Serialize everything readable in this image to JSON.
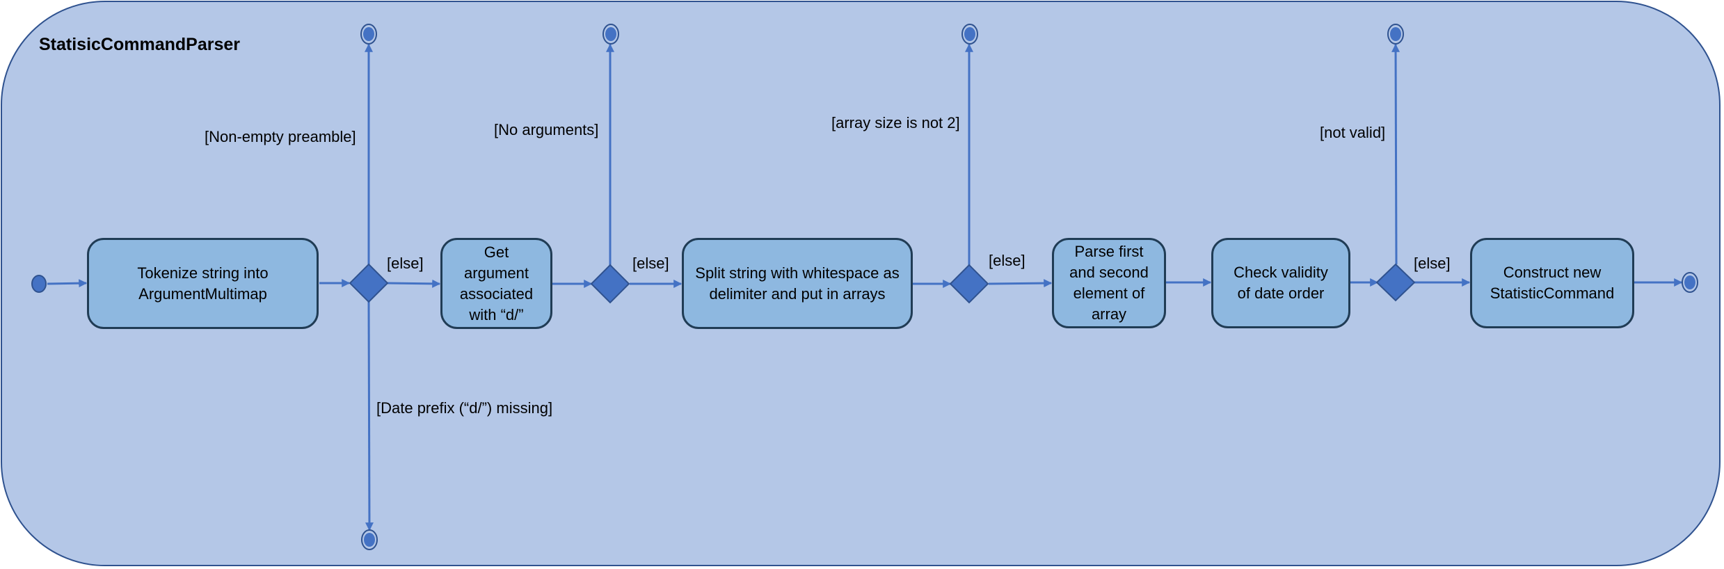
{
  "diagram": {
    "title": "StatisicCommandParser",
    "colors": {
      "frame_fill": "#b4c7e7",
      "frame_border": "#2f528f",
      "action_fill": "#8eb8e0",
      "action_border": "#203c55",
      "flow": "#4472c4",
      "node_fill": "#4472c4"
    },
    "actions": [
      {
        "id": "tokenize",
        "label": "Tokenize string into ArgumentMultimap"
      },
      {
        "id": "get-argument",
        "label": "Get argument associated with “d/”"
      },
      {
        "id": "split-string",
        "label": "Split string with whitespace as delimiter and put in arrays"
      },
      {
        "id": "parse-elements",
        "label": "Parse first and second element of array"
      },
      {
        "id": "check-validity",
        "label": "Check validity of date order"
      },
      {
        "id": "construct-command",
        "label": "Construct new StatisticCommand"
      }
    ],
    "decisions": [
      {
        "id": "decision-1",
        "else_label": "[else]",
        "guards": [
          {
            "direction": "up",
            "label": "[Non-empty preamble]"
          },
          {
            "direction": "down",
            "label": "[Date prefix (“d/”) missing]"
          }
        ]
      },
      {
        "id": "decision-2",
        "else_label": "[else]",
        "guards": [
          {
            "direction": "up",
            "label": "[No arguments]"
          }
        ]
      },
      {
        "id": "decision-3",
        "else_label": "[else]",
        "guards": [
          {
            "direction": "up",
            "label": "[array size is not 2]"
          }
        ]
      },
      {
        "id": "decision-4",
        "else_label": "[else]",
        "guards": [
          {
            "direction": "up",
            "label": "[not valid]"
          }
        ]
      }
    ],
    "flows": [
      {
        "from": "initial",
        "to": "tokenize"
      },
      {
        "from": "tokenize",
        "to": "decision-1"
      },
      {
        "from": "decision-1",
        "to": "get-argument",
        "guard": "[else]"
      },
      {
        "from": "decision-1",
        "to": "final-1",
        "guard": "[Non-empty preamble]"
      },
      {
        "from": "decision-1",
        "to": "final-5",
        "guard": "[Date prefix (“d/”) missing]"
      },
      {
        "from": "get-argument",
        "to": "decision-2"
      },
      {
        "from": "decision-2",
        "to": "split-string",
        "guard": "[else]"
      },
      {
        "from": "decision-2",
        "to": "final-2",
        "guard": "[No arguments]"
      },
      {
        "from": "split-string",
        "to": "decision-3"
      },
      {
        "from": "decision-3",
        "to": "parse-elements",
        "guard": "[else]"
      },
      {
        "from": "decision-3",
        "to": "final-3",
        "guard": "[array size is not 2]"
      },
      {
        "from": "parse-elements",
        "to": "check-validity"
      },
      {
        "from": "check-validity",
        "to": "decision-4"
      },
      {
        "from": "decision-4",
        "to": "construct-command",
        "guard": "[else]"
      },
      {
        "from": "decision-4",
        "to": "final-4",
        "guard": "[not valid]"
      },
      {
        "from": "construct-command",
        "to": "final-main"
      }
    ]
  }
}
